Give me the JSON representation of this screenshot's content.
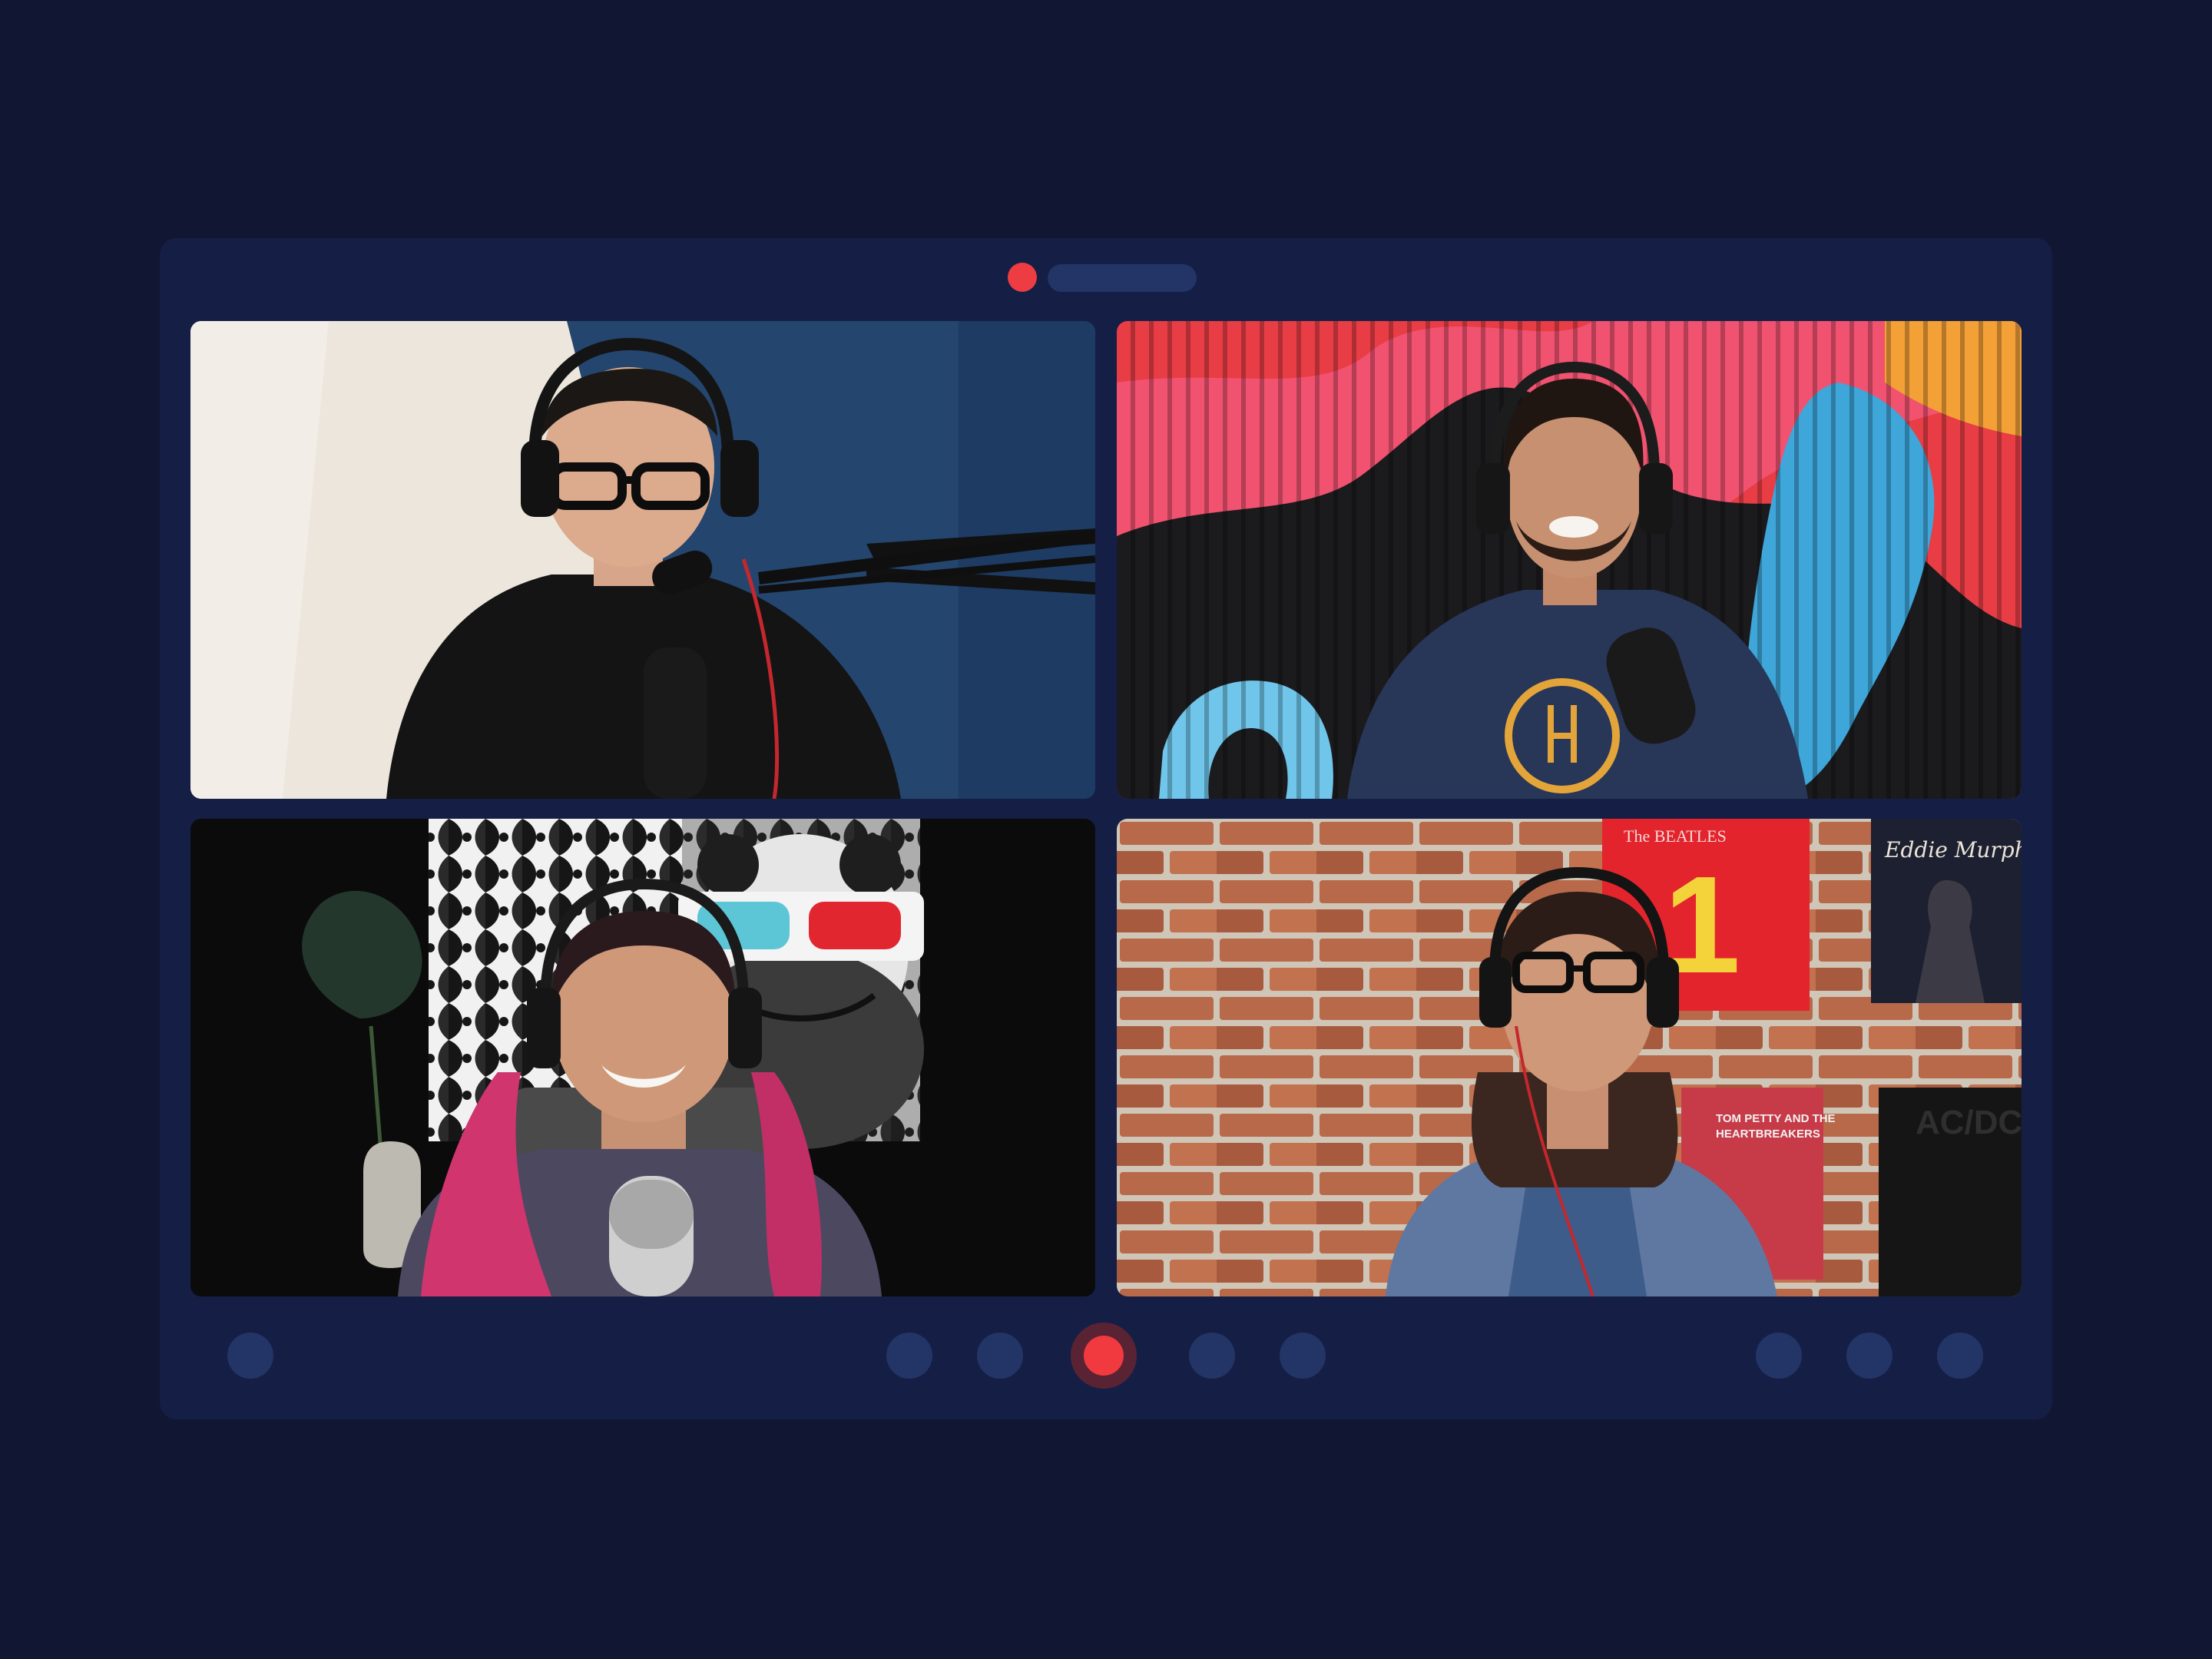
{
  "window": {
    "recording_indicator": "recording-dot",
    "title": ""
  },
  "participants": [
    {
      "tile": 1,
      "name": "",
      "scene": "man with glasses and headphones, boom microphone, white and blue wall"
    },
    {
      "tile": 2,
      "name": "",
      "scene": "smiling man with headphones, colorful graffiti corrugated wall"
    },
    {
      "tile": 3,
      "name": "",
      "scene": "smiling woman with pink hair, panda poster with 3D glasses"
    },
    {
      "tile": 4,
      "name": "",
      "scene": "woman with glasses and denim jacket, brick wall with records"
    }
  ],
  "posters": {
    "beatles_label": "The BEATLES",
    "beatles_number": "1",
    "eddie_label": "Eddie Murphy",
    "tom_petty_line1": "TOM PETTY AND THE",
    "tom_petty_line2": "HEARTBREAKERS",
    "acdc_label": "AC/DC"
  },
  "controls": {
    "left": [
      "settings-button"
    ],
    "center": [
      "mic-button",
      "camera-button",
      "record-button",
      "screen-share-button",
      "chat-button"
    ],
    "right": [
      "participants-button",
      "layout-button",
      "leave-button"
    ]
  },
  "colors": {
    "background": "#111633",
    "window": "#151f45",
    "button": "#233466",
    "record": "#f03a3f"
  }
}
